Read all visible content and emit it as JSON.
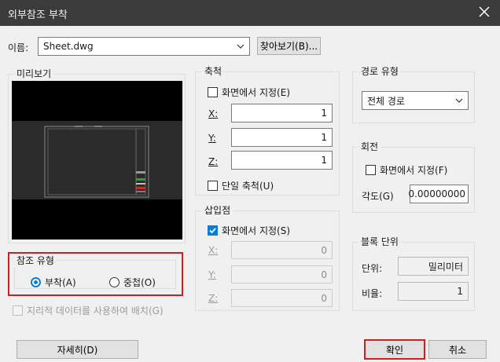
{
  "window": {
    "title": "외부참조 부착"
  },
  "name": {
    "label": "이름:",
    "value": "Sheet.dwg",
    "browse_label": "찾아보기(B)..."
  },
  "preview": {
    "label": "미리보기"
  },
  "ref_type": {
    "label": "참조 유형",
    "attach": "부착(A)",
    "overlay": "중첩(O)",
    "selected": "attach"
  },
  "geo": {
    "label": "지리적 데이터를 사용하여 배치(G)"
  },
  "scale": {
    "label": "축척",
    "specify": "화면에서 지정(E)",
    "x_label": "X:",
    "x": "1",
    "y_label": "Y:",
    "y": "1",
    "z_label": "Z:",
    "z": "1",
    "uniform": "단일 축척(U)"
  },
  "insert": {
    "label": "삽입점",
    "specify": "화면에서 지정(S)",
    "x_label": "X:",
    "x": "0",
    "y_label": "Y:",
    "y": "0",
    "z_label": "Z:",
    "z": "0"
  },
  "path": {
    "label": "경로 유형",
    "value": "전체 경로"
  },
  "rotation": {
    "label": "회전",
    "specify": "화면에서 지정(F)",
    "angle_label": "각도(G)",
    "angle": "0.00000000"
  },
  "block": {
    "label": "블록 단위",
    "unit_label": "단위:",
    "unit": "밀리미터",
    "factor_label": "비율:",
    "factor": "1"
  },
  "buttons": {
    "details": "자세히(D)",
    "ok": "확인",
    "cancel": "취소"
  },
  "colors": {
    "highlight": "#d11d1d",
    "accent": "#0a7ed6",
    "titlebar": "#3b3b3b"
  }
}
